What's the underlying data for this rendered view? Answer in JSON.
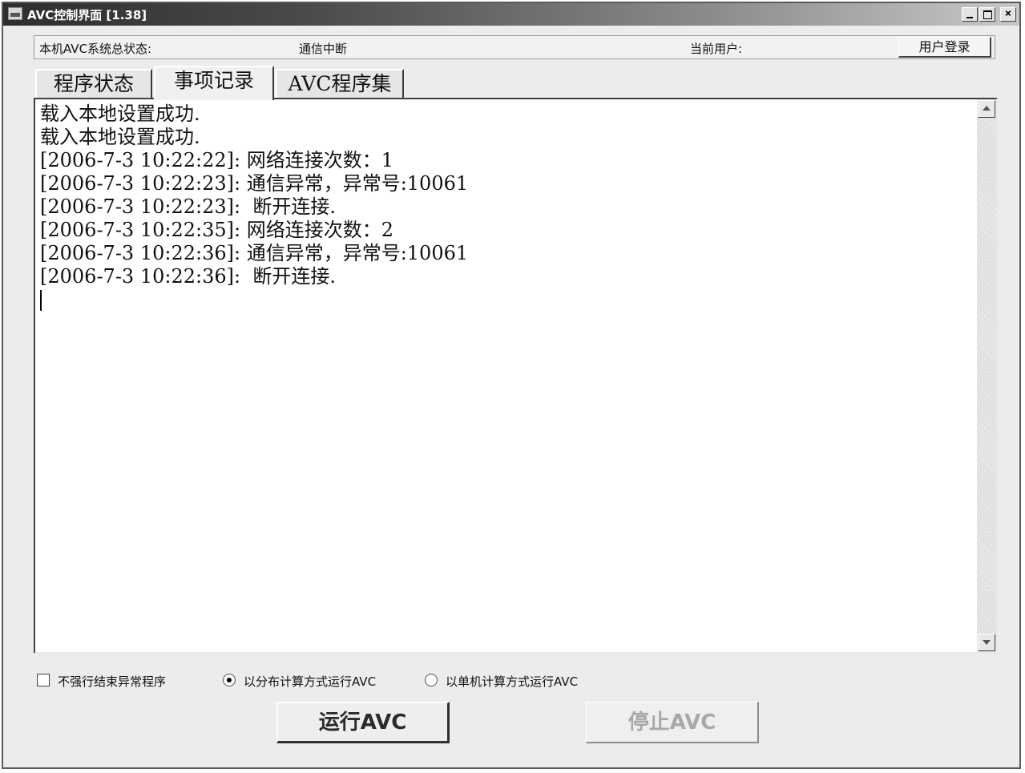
{
  "window": {
    "title": "AVC控制界面 [1.38]",
    "minimize_glyph": "_",
    "maximize_glyph": "□",
    "close_glyph": "×",
    "app_icon": "app-icon"
  },
  "status": {
    "system_label": "本机AVC系统总状态:",
    "system_value": "通信中断",
    "user_label": "当前用户:",
    "login_label": "用户登录"
  },
  "tabs": [
    {
      "label": "程序状态",
      "active": false
    },
    {
      "label": "事项记录",
      "active": true
    },
    {
      "label": "AVC程序集",
      "active": false
    }
  ],
  "log": {
    "lines": [
      "载入本地设置成功.",
      "载入本地设置成功.",
      "[2006-7-3 10:22:22]: 网络连接次数：1",
      "[2006-7-3 10:22:23]: 通信异常，异常号:10061",
      "[2006-7-3 10:22:23]:  断开连接.",
      "[2006-7-3 10:22:35]: 网络连接次数：2",
      "[2006-7-3 10:22:36]: 通信异常，异常号:10061",
      "[2006-7-3 10:22:36]:  断开连接."
    ]
  },
  "options": {
    "force_end_label": "不强行结束异常程序",
    "force_end_checked": false,
    "distributed_label": "以分布计算方式运行AVC",
    "distributed_selected": true,
    "standalone_label": "以单机计算方式运行AVC",
    "standalone_selected": false
  },
  "actions": {
    "run_label": "运行AVC",
    "stop_label": "停止AVC",
    "stop_enabled": false
  },
  "colors": {
    "window_bg": "#ececec",
    "titlebar_dark": "#2e2e2e",
    "titlebar_light": "#c8c8c8",
    "disabled_text": "#a8a8a8"
  }
}
